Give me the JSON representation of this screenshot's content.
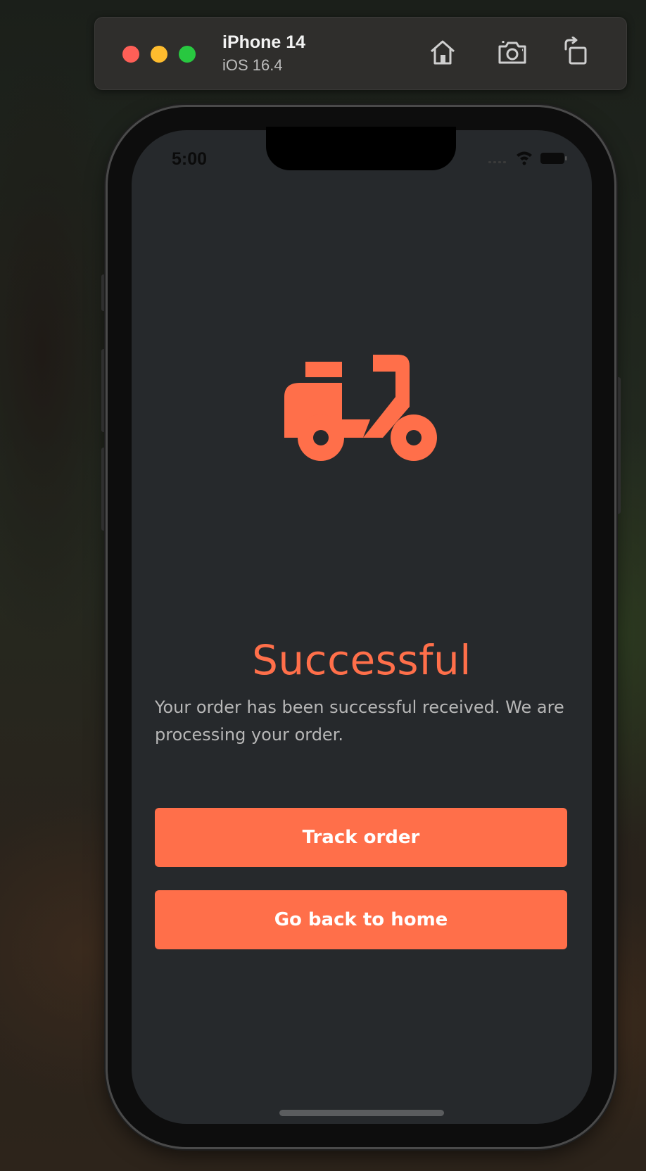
{
  "simulator": {
    "device_name": "iPhone 14",
    "os_version": "iOS 16.4",
    "toolbar_icons": [
      "home-icon",
      "screenshot-icon",
      "rotate-icon"
    ],
    "window_controls": [
      "close",
      "minimize",
      "zoom"
    ]
  },
  "status_bar": {
    "time": "5:00",
    "icons": [
      "signal-icon",
      "wifi-icon",
      "battery-icon"
    ]
  },
  "app": {
    "hero_icon": "scooter-icon",
    "title": "Successful",
    "message": "Your order has been successful received. We are processing your order.",
    "buttons": {
      "track_order": "Track order",
      "go_home": "Go back to home"
    },
    "colors": {
      "accent": "#ff6f4a",
      "background": "#26292c",
      "message_text": "#b7b7b7"
    }
  }
}
